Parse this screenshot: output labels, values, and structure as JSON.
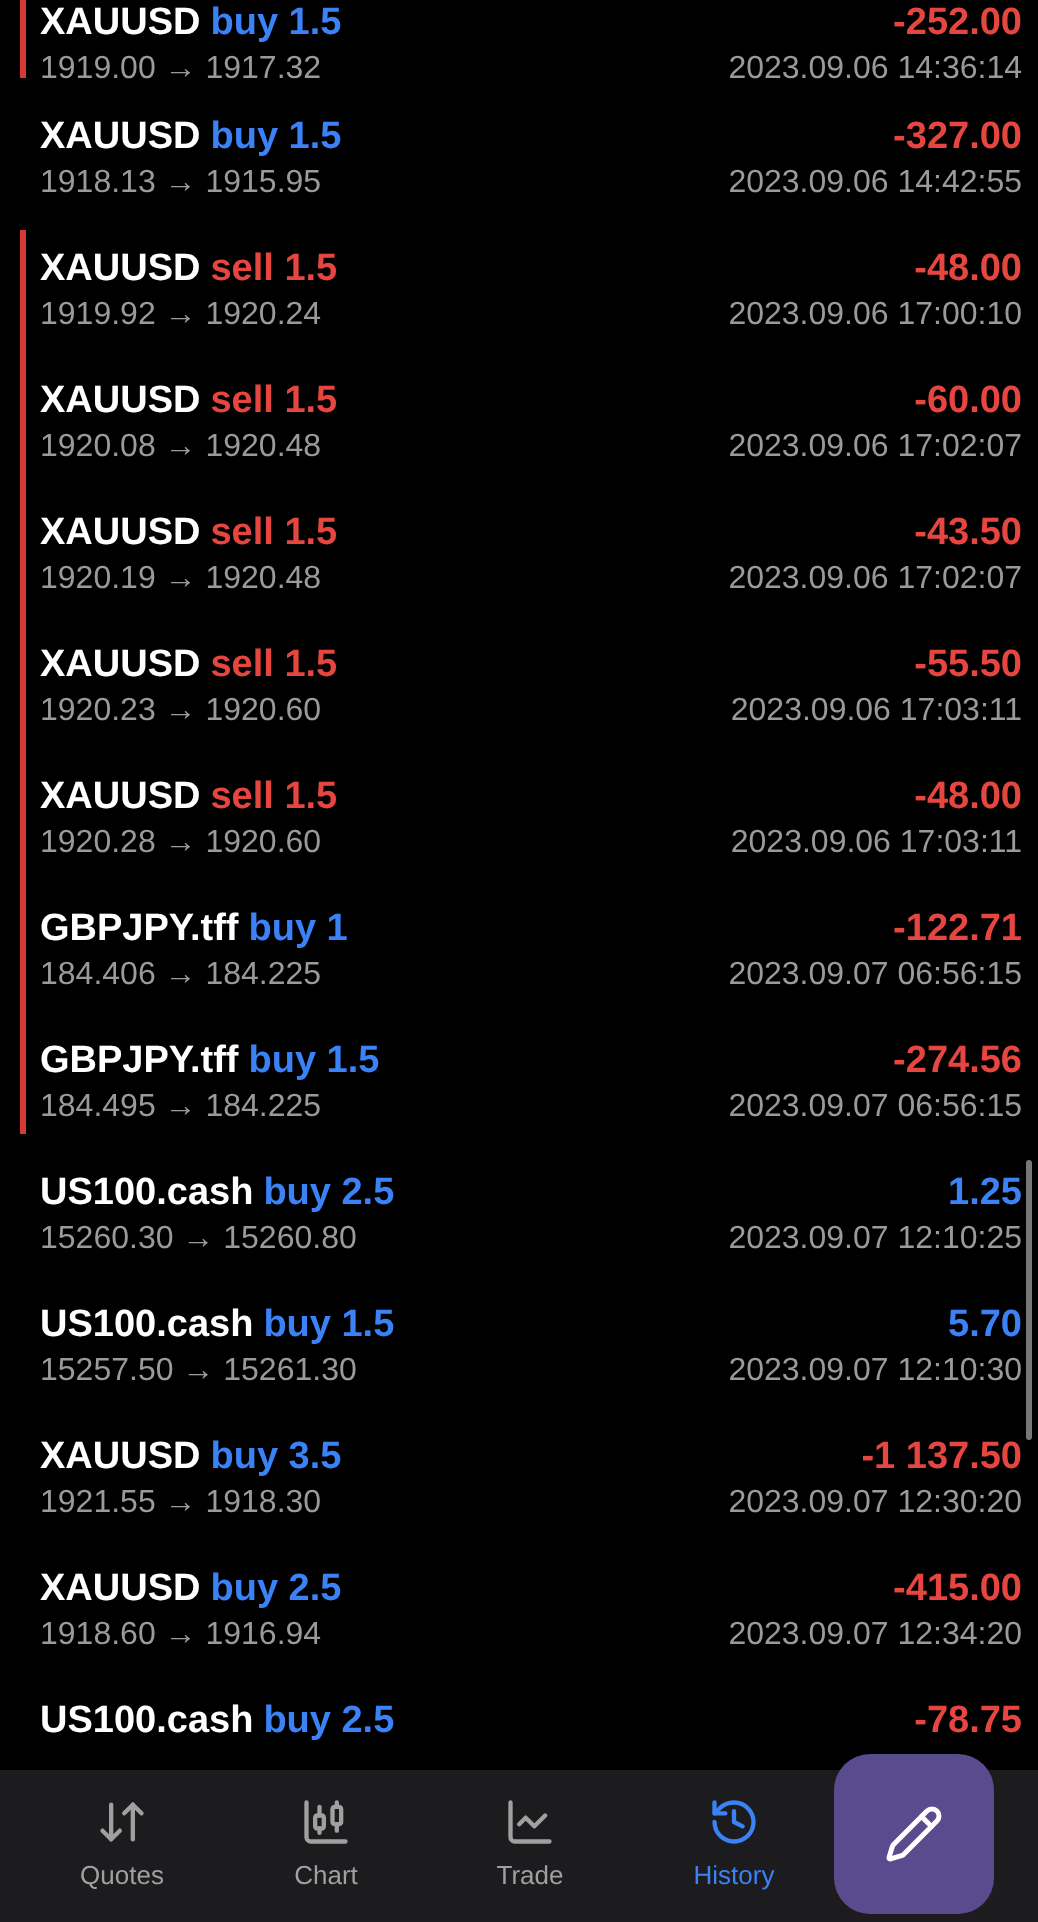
{
  "deals": [
    {
      "symbol": "XAUUSD",
      "order": "buy 1.5",
      "kind": "buy",
      "prices": "1919.00 → 1917.32",
      "profit": "-252.00",
      "profit_positive": false,
      "time": "2023.09.06 14:36:14",
      "marked": true
    },
    {
      "symbol": "XAUUSD",
      "order": "buy 1.5",
      "kind": "buy",
      "prices": "1918.13 → 1915.95",
      "profit": "-327.00",
      "profit_positive": false,
      "time": "2023.09.06 14:42:55",
      "marked": false
    },
    {
      "symbol": "XAUUSD",
      "order": "sell 1.5",
      "kind": "sell",
      "prices": "1919.92 → 1920.24",
      "profit": "-48.00",
      "profit_positive": false,
      "time": "2023.09.06 17:00:10",
      "marked": true
    },
    {
      "symbol": "XAUUSD",
      "order": "sell 1.5",
      "kind": "sell",
      "prices": "1920.08 → 1920.48",
      "profit": "-60.00",
      "profit_positive": false,
      "time": "2023.09.06 17:02:07",
      "marked": true
    },
    {
      "symbol": "XAUUSD",
      "order": "sell 1.5",
      "kind": "sell",
      "prices": "1920.19 → 1920.48",
      "profit": "-43.50",
      "profit_positive": false,
      "time": "2023.09.06 17:02:07",
      "marked": true
    },
    {
      "symbol": "XAUUSD",
      "order": "sell 1.5",
      "kind": "sell",
      "prices": "1920.23 → 1920.60",
      "profit": "-55.50",
      "profit_positive": false,
      "time": "2023.09.06 17:03:11",
      "marked": true
    },
    {
      "symbol": "XAUUSD",
      "order": "sell 1.5",
      "kind": "sell",
      "prices": "1920.28 → 1920.60",
      "profit": "-48.00",
      "profit_positive": false,
      "time": "2023.09.06 17:03:11",
      "marked": true
    },
    {
      "symbol": "GBPJPY.tff",
      "order": "buy 1",
      "kind": "buy",
      "prices": "184.406 → 184.225",
      "profit": "-122.71",
      "profit_positive": false,
      "time": "2023.09.07 06:56:15",
      "marked": true
    },
    {
      "symbol": "GBPJPY.tff",
      "order": "buy 1.5",
      "kind": "buy",
      "prices": "184.495 → 184.225",
      "profit": "-274.56",
      "profit_positive": false,
      "time": "2023.09.07 06:56:15",
      "marked": true
    },
    {
      "symbol": "US100.cash",
      "order": "buy 2.5",
      "kind": "buy",
      "prices": "15260.30 → 15260.80",
      "profit": "1.25",
      "profit_positive": true,
      "time": "2023.09.07 12:10:25",
      "marked": false
    },
    {
      "symbol": "US100.cash",
      "order": "buy 1.5",
      "kind": "buy",
      "prices": "15257.50 → 15261.30",
      "profit": "5.70",
      "profit_positive": true,
      "time": "2023.09.07 12:10:30",
      "marked": false
    },
    {
      "symbol": "XAUUSD",
      "order": "buy 3.5",
      "kind": "buy",
      "prices": "1921.55 → 1918.30",
      "profit": "-1 137.50",
      "profit_positive": false,
      "time": "2023.09.07 12:30:20",
      "marked": false
    },
    {
      "symbol": "XAUUSD",
      "order": "buy 2.5",
      "kind": "buy",
      "prices": "1918.60 → 1916.94",
      "profit": "-415.00",
      "profit_positive": false,
      "time": "2023.09.07 12:34:20",
      "marked": false
    },
    {
      "symbol": "US100.cash",
      "order": "buy 2.5",
      "kind": "buy",
      "profit": "-78.75",
      "profit_positive": false,
      "marked": false
    }
  ],
  "nav": [
    {
      "label": "Quotes",
      "selected": false
    },
    {
      "label": "Chart",
      "selected": false
    },
    {
      "label": "Trade",
      "selected": false
    },
    {
      "label": "History",
      "selected": true
    }
  ]
}
